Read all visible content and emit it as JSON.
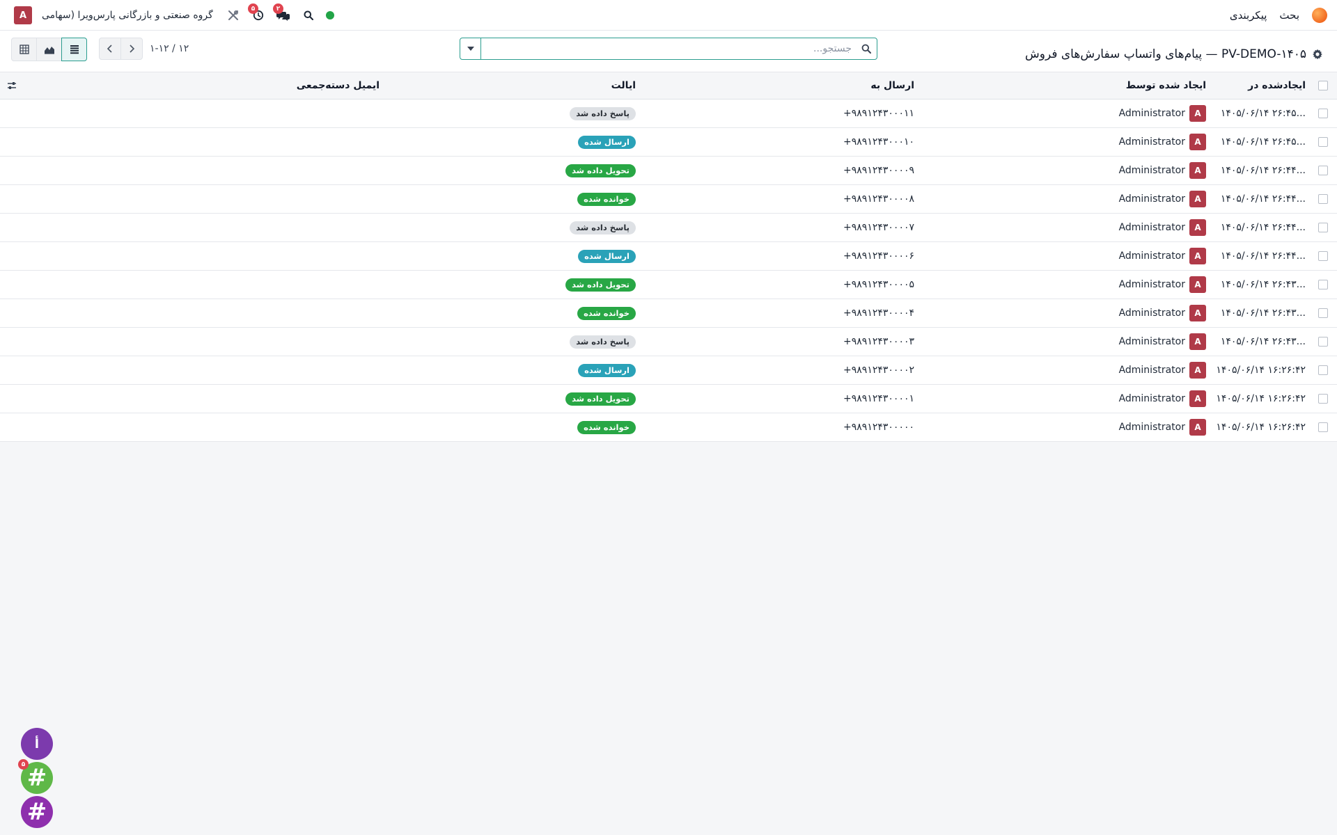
{
  "navbar": {
    "menu_discuss": "بحث",
    "menu_config": "پیکربندی",
    "user_initial": "A",
    "company": "گروه صنعتی و بازرگانی پارس‌ویرا (سهامی ...",
    "activity_badge": "۵",
    "messages_badge": "۲",
    "icons": [
      "app-logo",
      "tools-icon",
      "clock-icon",
      "chat-icon",
      "search-icon",
      "online-status"
    ]
  },
  "control": {
    "title": "پیام‌های واتساپ سفارش‌های فروش — PV-DEMO-۱۴۰۵",
    "search_placeholder": "جستجو...",
    "pager_value": "۱-۱۲ / ۱۲",
    "views": [
      "list",
      "graph",
      "pivot"
    ],
    "active_view": "list"
  },
  "table": {
    "headers": {
      "created_on": "ایجادشده در",
      "created_by": "ایجاد شده توسط",
      "send_to": "ارسال به",
      "state": "ایالت",
      "mass_mail": "ایمیل دسته‌جمعی"
    },
    "rows": [
      {
        "date": "۱۴۰۵/۰۶/۱۴ ۲۶:۴۵...",
        "user": "Administrator",
        "initial": "A",
        "phone": "+۹۸۹۱۲۴۳۰۰۰۱۱",
        "state": "پاسخ داده شد",
        "state_key": "replied"
      },
      {
        "date": "۱۴۰۵/۰۶/۱۴ ۲۶:۴۵...",
        "user": "Administrator",
        "initial": "A",
        "phone": "+۹۸۹۱۲۴۳۰۰۰۱۰",
        "state": "ارسال شده",
        "state_key": "sent"
      },
      {
        "date": "۱۴۰۵/۰۶/۱۴ ۲۶:۴۴...",
        "user": "Administrator",
        "initial": "A",
        "phone": "+۹۸۹۱۲۴۳۰۰۰۰۹",
        "state": "تحویل داده شد",
        "state_key": "delivered"
      },
      {
        "date": "۱۴۰۵/۰۶/۱۴ ۲۶:۴۴...",
        "user": "Administrator",
        "initial": "A",
        "phone": "+۹۸۹۱۲۴۳۰۰۰۰۸",
        "state": "خوانده شده",
        "state_key": "read"
      },
      {
        "date": "۱۴۰۵/۰۶/۱۴ ۲۶:۴۴...",
        "user": "Administrator",
        "initial": "A",
        "phone": "+۹۸۹۱۲۴۳۰۰۰۰۷",
        "state": "پاسخ داده شد",
        "state_key": "replied"
      },
      {
        "date": "۱۴۰۵/۰۶/۱۴ ۲۶:۴۴...",
        "user": "Administrator",
        "initial": "A",
        "phone": "+۹۸۹۱۲۴۳۰۰۰۰۶",
        "state": "ارسال شده",
        "state_key": "sent"
      },
      {
        "date": "۱۴۰۵/۰۶/۱۴ ۲۶:۴۳...",
        "user": "Administrator",
        "initial": "A",
        "phone": "+۹۸۹۱۲۴۳۰۰۰۰۵",
        "state": "تحویل داده شد",
        "state_key": "delivered"
      },
      {
        "date": "۱۴۰۵/۰۶/۱۴ ۲۶:۴۳...",
        "user": "Administrator",
        "initial": "A",
        "phone": "+۹۸۹۱۲۴۳۰۰۰۰۴",
        "state": "خوانده شده",
        "state_key": "read"
      },
      {
        "date": "۱۴۰۵/۰۶/۱۴ ۲۶:۴۳...",
        "user": "Administrator",
        "initial": "A",
        "phone": "+۹۸۹۱۲۴۳۰۰۰۰۳",
        "state": "پاسخ داده شد",
        "state_key": "replied"
      },
      {
        "date": "۱۴۰۵/۰۶/۱۴ ۱۶:۲۶:۴۲",
        "user": "Administrator",
        "initial": "A",
        "phone": "+۹۸۹۱۲۴۳۰۰۰۰۲",
        "state": "ارسال شده",
        "state_key": "sent"
      },
      {
        "date": "۱۴۰۵/۰۶/۱۴ ۱۶:۲۶:۴۲",
        "user": "Administrator",
        "initial": "A",
        "phone": "+۹۸۹۱۲۴۳۰۰۰۰۱",
        "state": "تحویل داده شد",
        "state_key": "delivered"
      },
      {
        "date": "۱۴۰۵/۰۶/۱۴ ۱۶:۲۶:۴۲",
        "user": "Administrator",
        "initial": "A",
        "phone": "+۹۸۹۱۲۴۳۰۰۰۰۰",
        "state": "خوانده شده",
        "state_key": "read"
      }
    ]
  },
  "chat_bubbles": [
    {
      "label": "أ",
      "badge": ""
    },
    {
      "label": "#",
      "badge": "۵"
    },
    {
      "label": "#",
      "badge": ""
    }
  ],
  "colors": {
    "accent": "#2a9d8f",
    "avatar": "#b03a48",
    "badge_sent": "#2aa2b8",
    "badge_success": "#28a745",
    "badge_neutral": "#dee1e5"
  }
}
